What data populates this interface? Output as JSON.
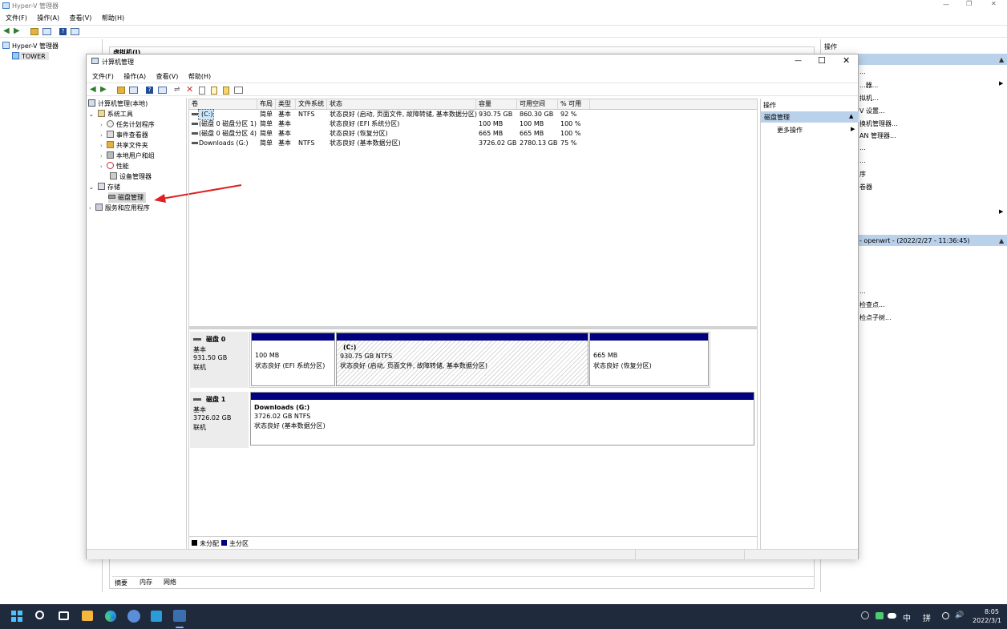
{
  "hyperv": {
    "title": "Hyper-V 管理器",
    "menu": [
      "文件(F)",
      "操作(A)",
      "查看(V)",
      "帮助(H)"
    ],
    "tree_root": "Hyper-V 管理器",
    "tree_child": "TOWER",
    "vm_header": "虚拟机(I)",
    "actions_title": "操作",
    "right_items": [
      "...",
      "...器...",
      "拟机...",
      "V 设置...",
      "换机管理器...",
      "AN 管理器...",
      "...",
      "...",
      "序",
      "卷器",
      "- openwrt - (2022/2/27 - 11:36:45)",
      "...",
      "检查点...",
      "检点子树..."
    ],
    "bottom_tabs": [
      "摘要",
      "内存",
      "网络"
    ]
  },
  "cm": {
    "title": "计算机管理",
    "menu": [
      "文件(F)",
      "操作(A)",
      "查看(V)",
      "帮助(H)"
    ],
    "tree": {
      "root": "计算机管理(本地)",
      "system_tools": "系统工具",
      "task_scheduler": "任务计划程序",
      "event_viewer": "事件查看器",
      "shared_folders": "共享文件夹",
      "local_users": "本地用户和组",
      "performance": "性能",
      "device_manager": "设备管理器",
      "storage": "存储",
      "disk_management": "磁盘管理",
      "services_apps": "服务和应用程序"
    },
    "columns": [
      "卷",
      "布局",
      "类型",
      "文件系统",
      "状态",
      "容量",
      "可用空间",
      "% 可用"
    ],
    "volumes": [
      {
        "name": "(C:)",
        "layout": "简单",
        "type": "基本",
        "fs": "NTFS",
        "status": "状态良好 (启动, 页面文件, 故障转储, 基本数据分区)",
        "capacity": "930.75 GB",
        "free": "860.30 GB",
        "pct": "92 %"
      },
      {
        "name": "(磁盘 0 磁盘分区 1)",
        "layout": "简单",
        "type": "基本",
        "fs": "",
        "status": "状态良好 (EFI 系统分区)",
        "capacity": "100 MB",
        "free": "100 MB",
        "pct": "100 %"
      },
      {
        "name": "(磁盘 0 磁盘分区 4)",
        "layout": "简单",
        "type": "基本",
        "fs": "",
        "status": "状态良好 (恢复分区)",
        "capacity": "665 MB",
        "free": "665 MB",
        "pct": "100 %"
      },
      {
        "name": "Downloads (G:)",
        "layout": "简单",
        "type": "基本",
        "fs": "NTFS",
        "status": "状态良好 (基本数据分区)",
        "capacity": "3726.02 GB",
        "free": "2780.13 GB",
        "pct": "75 %"
      }
    ],
    "disk0": {
      "name": "磁盘 0",
      "kind": "基本",
      "size": "931.50 GB",
      "state": "联机",
      "p1": {
        "size": "100 MB",
        "status": "状态良好 (EFI 系统分区)"
      },
      "p2": {
        "label": "(C:)",
        "size": "930.75 GB NTFS",
        "status": "状态良好 (启动, 页面文件, 故障转储, 基本数据分区)"
      },
      "p3": {
        "size": "665 MB",
        "status": "状态良好 (恢复分区)"
      }
    },
    "disk1": {
      "name": "磁盘 1",
      "kind": "基本",
      "size": "3726.02 GB",
      "state": "联机",
      "p1": {
        "label": "Downloads  (G:)",
        "size": "3726.02 GB NTFS",
        "status": "状态良好 (基本数据分区)"
      }
    },
    "legend": {
      "unallocated": "未分配",
      "primary": "主分区"
    },
    "actions": {
      "title": "操作",
      "section": "磁盘管理",
      "more": "更多操作"
    }
  },
  "taskbar": {
    "ime1": "中",
    "ime2": "拼",
    "time": "8:05",
    "date": "2022/3/1"
  },
  "colors": {
    "primary_partition": "#000080",
    "selection": "#cce8ff",
    "action_header": "#b9d1ea"
  }
}
